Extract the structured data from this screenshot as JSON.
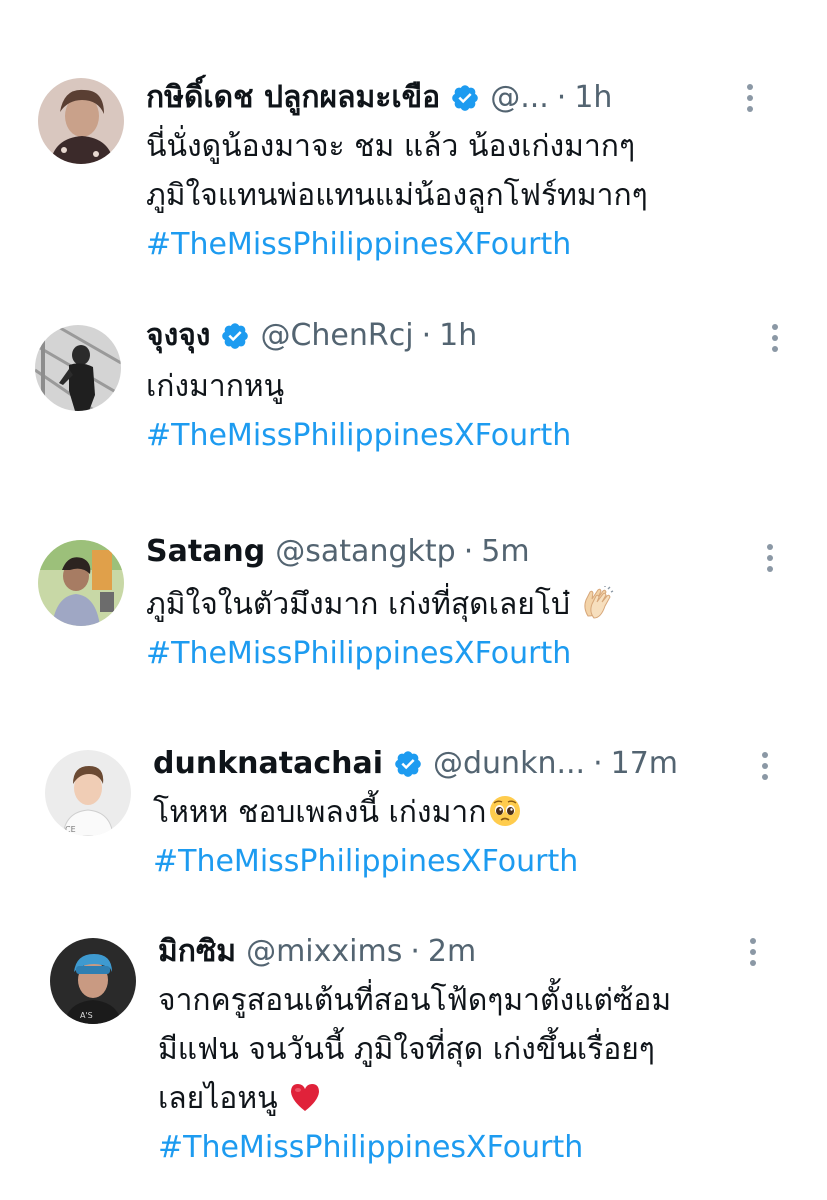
{
  "tweets": [
    {
      "name": "กษิดิ์เดช ปลูกผลมะเขือ",
      "verified": true,
      "handle": "@...",
      "time": "1h",
      "lines": [
        "นี่นั่งดูน้องมาจะ ชม แล้ว น้องเก่งมากๆ",
        "ภูมิใจแทนพ่อแทนแม่น้องลูกโฟร์ทมากๆ"
      ],
      "hashtag": "#TheMissPhilippinesXFourth"
    },
    {
      "name": "จุงจุง",
      "verified": true,
      "handle": "@ChenRcj",
      "time": "1h",
      "lines": [
        "เก่งมากหนู"
      ],
      "hashtag": "#TheMissPhilippinesXFourth"
    },
    {
      "name": "Satang",
      "verified": false,
      "handle": "@satangktp",
      "time": "5m",
      "lines": [
        "ภูมิใจในตัวมึงมาก เก่งที่สุดเลยโบ๋"
      ],
      "emoji": "clapping-hands",
      "hashtag": "#TheMissPhilippinesXFourth"
    },
    {
      "name": "dunknatachai",
      "verified": true,
      "handle": "@dunkn...",
      "time": "17m",
      "lines": [
        "โหหห ชอบเพลงนี้ เก่งมาก"
      ],
      "emoji": "pleading-face",
      "hashtag": "#TheMissPhilippinesXFourth"
    },
    {
      "name": "มิกซิม",
      "verified": false,
      "handle": "@mixxims",
      "time": "2m",
      "lines": [
        "จากครูสอนเต้นที่สอนโฟ้ดๆมาตั้งแต่ซ้อม",
        "มีแฟน จนวันนี้ ภูมิใจที่สุด เก่งขึ้นเรื่อยๆ",
        "เลยไอหนู"
      ],
      "emoji": "red-heart",
      "hashtag": "#TheMissPhilippinesXFourth"
    }
  ],
  "separator": "·",
  "colors": {
    "text": "#0f1419",
    "secondary": "#536471",
    "link": "#1d9bf0",
    "verified": "#1d9bf0"
  }
}
